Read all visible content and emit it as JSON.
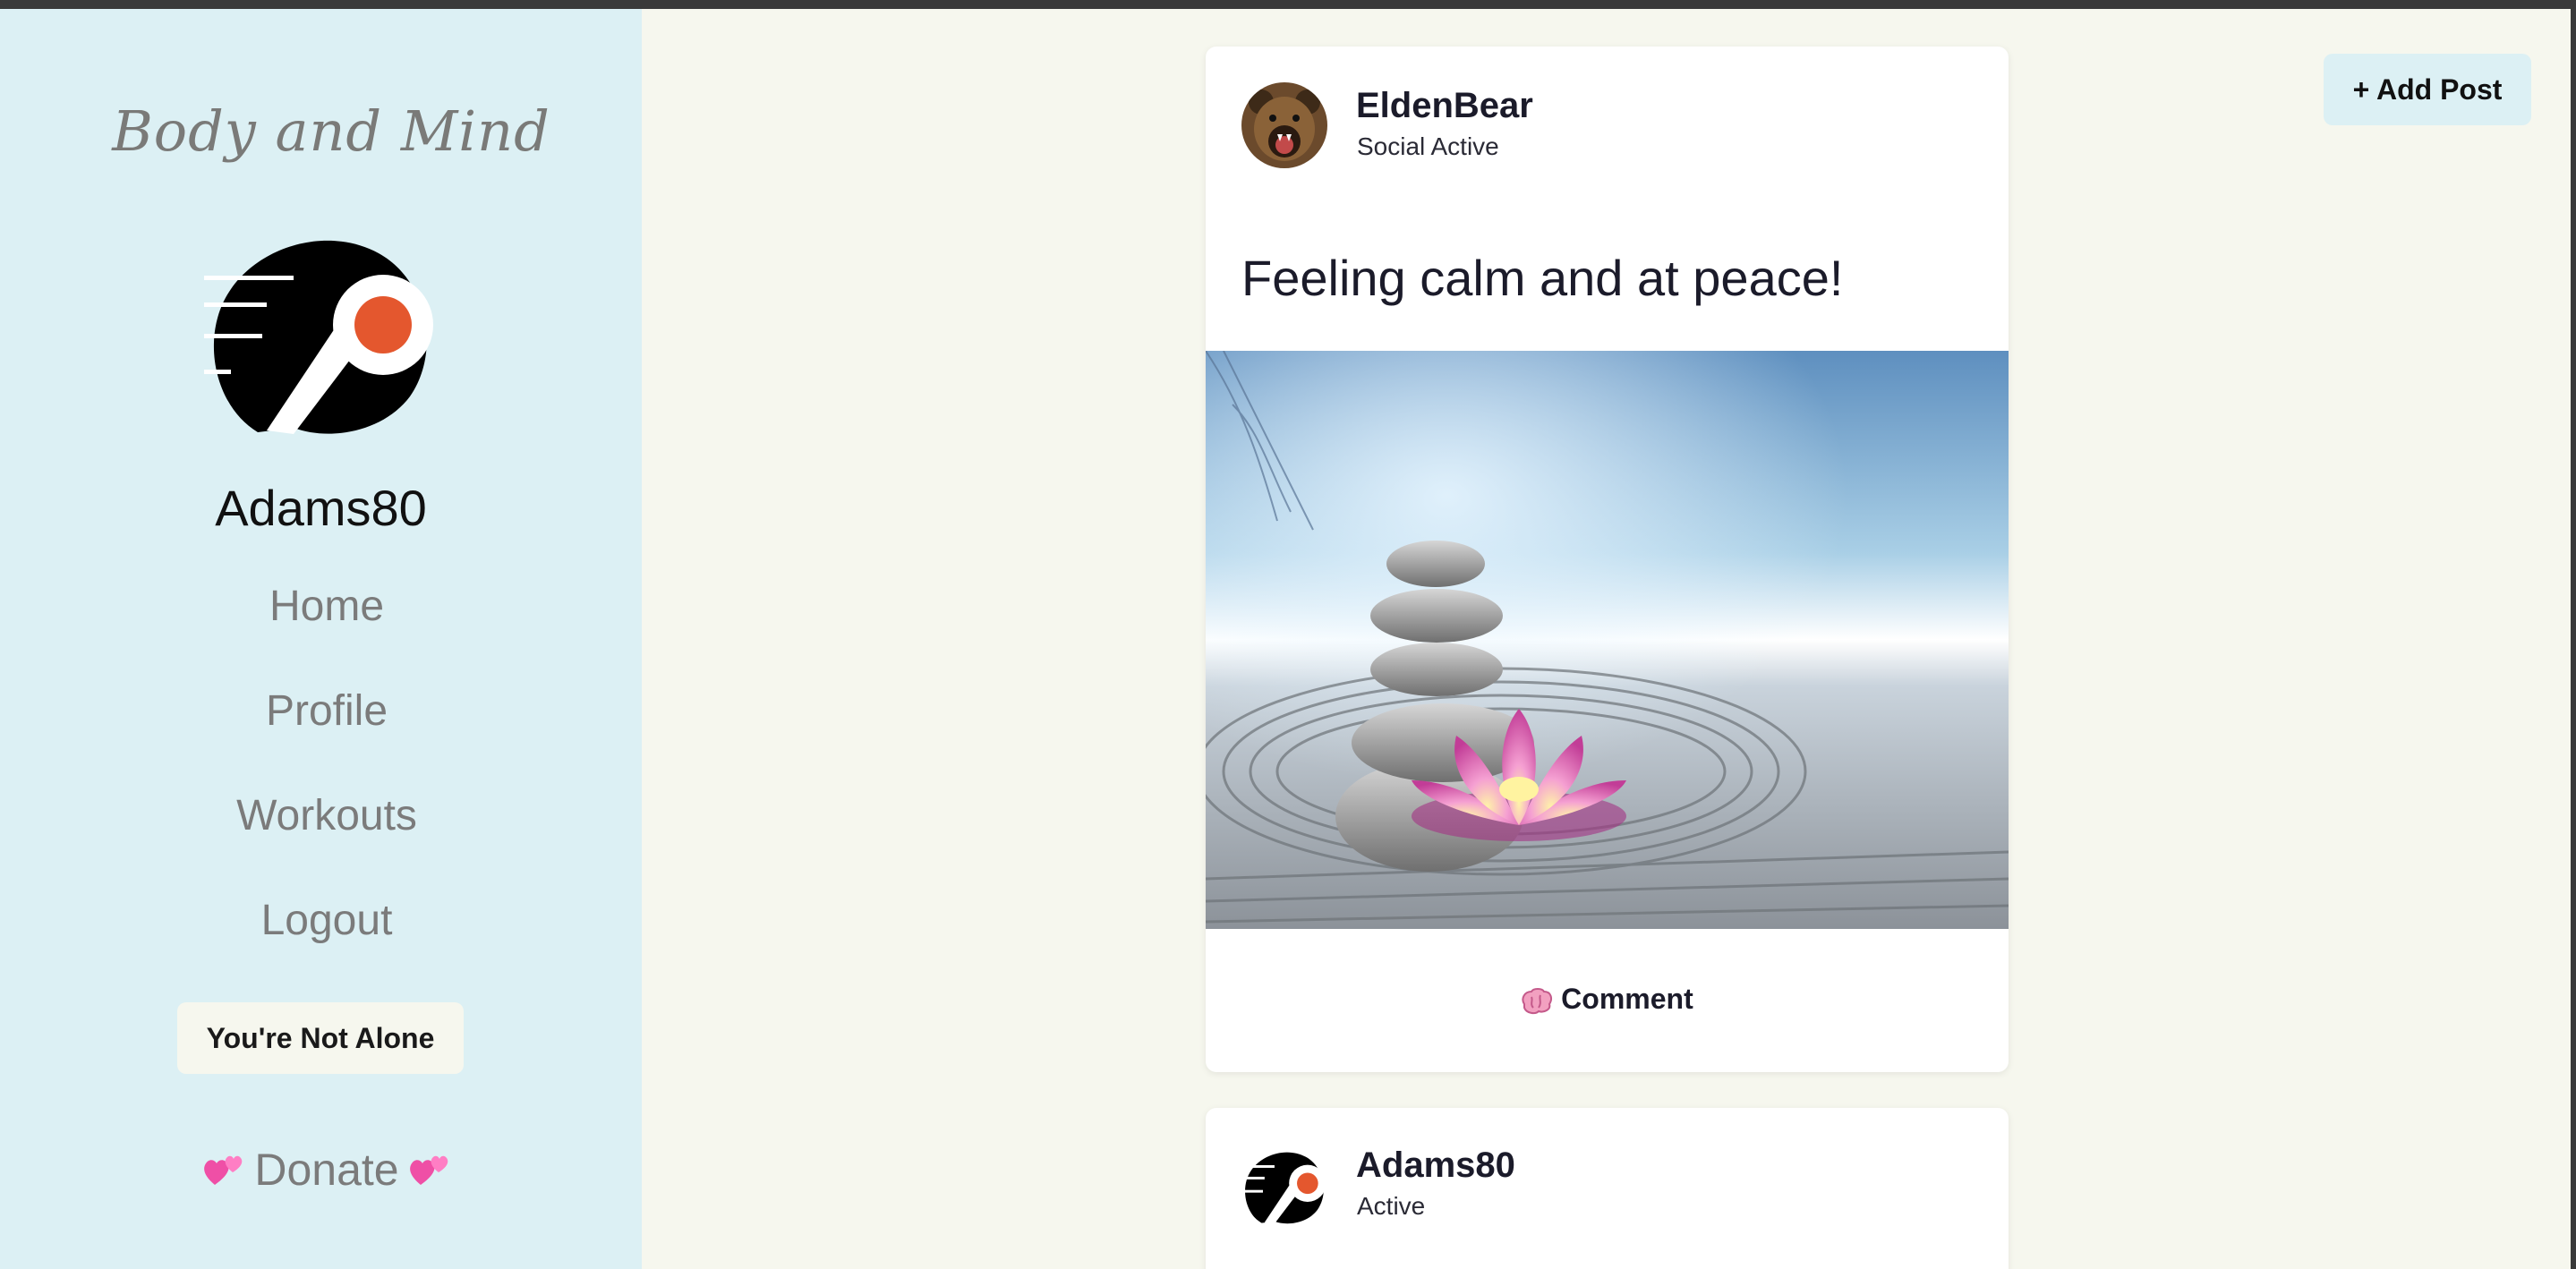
{
  "sidebar": {
    "brand": "Body and Mind",
    "username": "Adams80",
    "nav": {
      "home": "Home",
      "profile": "Profile",
      "workouts": "Workouts",
      "logout": "Logout"
    },
    "support_button": "You're Not Alone",
    "donate": "Donate"
  },
  "toolbar": {
    "add_post": "+ Add Post"
  },
  "posts": [
    {
      "author": "EldenBear",
      "status": "Social Active",
      "text": "Feeling calm and at peace!",
      "comment_label": "Comment",
      "comment_icon": "brain-icon"
    },
    {
      "author": "Adams80",
      "status": "Active"
    }
  ],
  "colors": {
    "sidebar_bg": "#dcf0f4",
    "main_bg": "#f6f7ee",
    "logo_orange": "#e4572e"
  }
}
